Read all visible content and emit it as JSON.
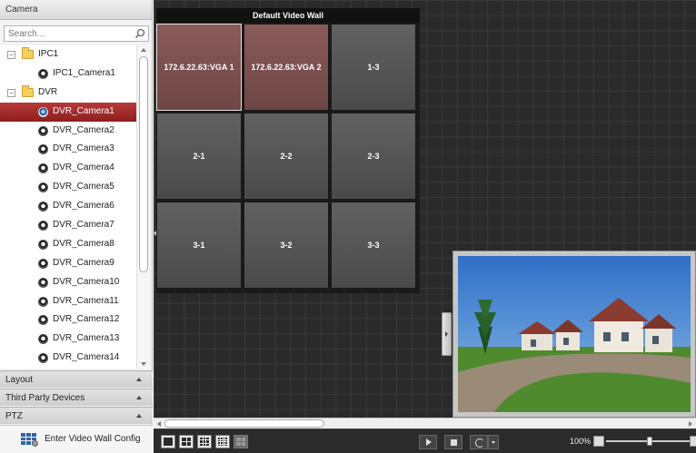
{
  "left_panel": {
    "header": "Camera",
    "search_placeholder": "Search...",
    "tree": [
      {
        "type": "group",
        "label": "IPC1",
        "expander": "−"
      },
      {
        "type": "camera",
        "label": "IPC1_Camera1"
      },
      {
        "type": "group",
        "label": "DVR",
        "expander": "−"
      },
      {
        "type": "camera",
        "label": "DVR_Camera1",
        "selected": true
      },
      {
        "type": "camera",
        "label": "DVR_Camera2"
      },
      {
        "type": "camera",
        "label": "DVR_Camera3"
      },
      {
        "type": "camera",
        "label": "DVR_Camera4"
      },
      {
        "type": "camera",
        "label": "DVR_Camera5"
      },
      {
        "type": "camera",
        "label": "DVR_Camera6"
      },
      {
        "type": "camera",
        "label": "DVR_Camera7"
      },
      {
        "type": "camera",
        "label": "DVR_Camera8"
      },
      {
        "type": "camera",
        "label": "DVR_Camera9"
      },
      {
        "type": "camera",
        "label": "DVR_Camera10"
      },
      {
        "type": "camera",
        "label": "DVR_Camera11"
      },
      {
        "type": "camera",
        "label": "DVR_Camera12"
      },
      {
        "type": "camera",
        "label": "DVR_Camera13"
      },
      {
        "type": "camera",
        "label": "DVR_Camera14"
      }
    ],
    "accordions": [
      "Layout",
      "Third Party Devices",
      "PTZ"
    ],
    "enter_button": "Enter Video Wall Config"
  },
  "wall": {
    "title": "Default Video Wall",
    "cells": [
      "172.6.22.63:VGA 1",
      "172.6.22.63:VGA 2",
      "1-3",
      "2-1",
      "2-2",
      "2-3",
      "3-1",
      "3-2",
      "3-3"
    ]
  },
  "toolbar": {
    "zoom": "100%"
  },
  "colors": {
    "selection": "#9e2a2a",
    "vga_cell": "#7d5050",
    "cell": "#555555",
    "canvas": "#2a2a2a"
  }
}
